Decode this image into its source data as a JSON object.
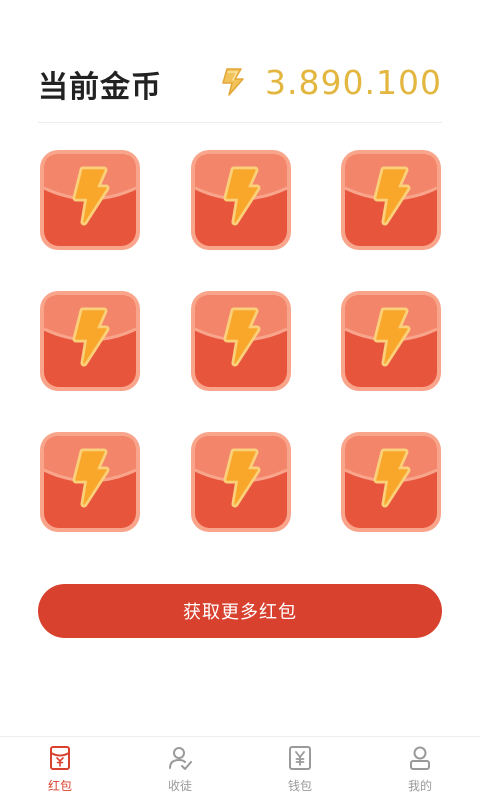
{
  "header": {
    "title": "当前金币",
    "balance": "3.890.100",
    "coin_icon": "lightning-coin-icon"
  },
  "envelopes": {
    "count": 9,
    "icon": "red-envelope-icon",
    "colors": {
      "body": "#e8553d",
      "flap": "#f3866a",
      "border": "#f9a58c",
      "bolt": "#f9a72a"
    }
  },
  "cta": {
    "label": "获取更多红包"
  },
  "tabbar": {
    "tabs": [
      {
        "label": "红包",
        "icon": "red-envelope-tab-icon",
        "active": true
      },
      {
        "label": "收徒",
        "icon": "user-check-icon",
        "active": false
      },
      {
        "label": "钱包",
        "icon": "wallet-yen-icon",
        "active": false
      },
      {
        "label": "我的",
        "icon": "user-icon",
        "active": false
      }
    ]
  },
  "colors": {
    "accent": "#d9412f",
    "gold": "#e2b63f",
    "inactive": "#9a9a9a"
  }
}
